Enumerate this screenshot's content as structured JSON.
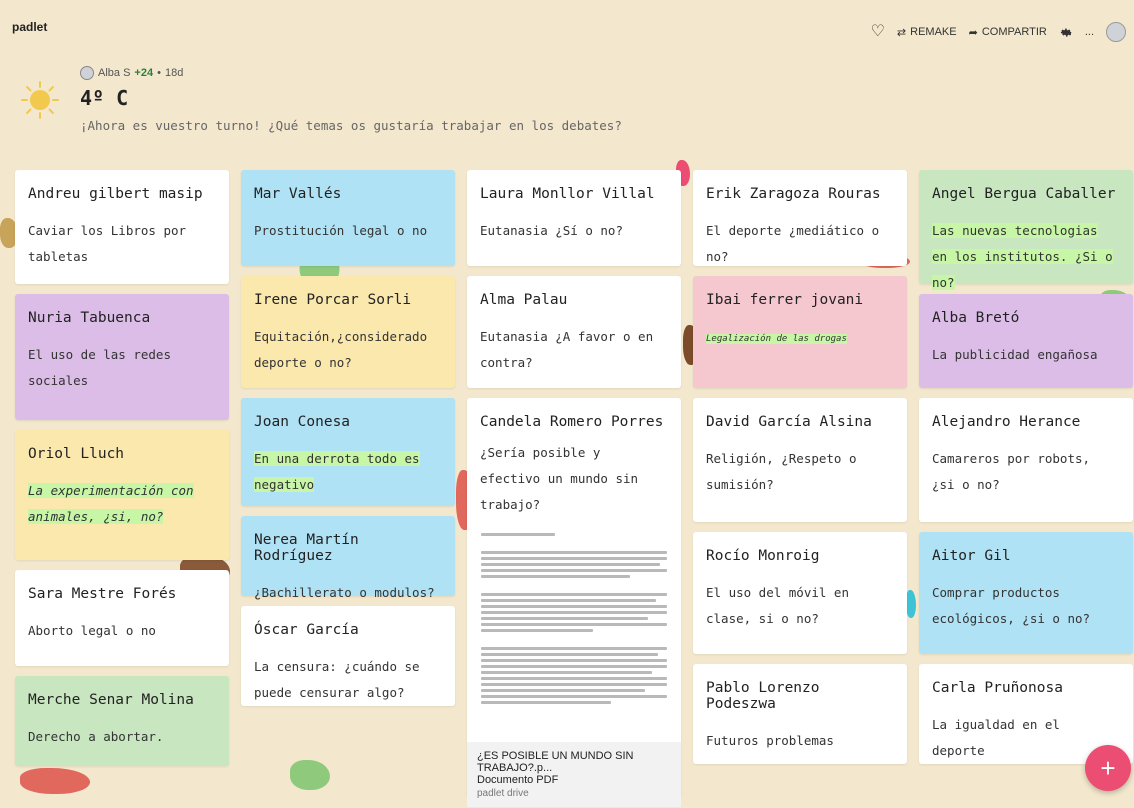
{
  "app": {
    "brand": "padlet",
    "actions": {
      "remake": "REMAKE",
      "share": "COMPARTIR",
      "more": "..."
    }
  },
  "header": {
    "author": "Alba S",
    "contributors": "+24",
    "separator": "•",
    "age": "18d",
    "title": "4º C",
    "description": "¡Ahora es vuestro turno! ¿Qué temas os gustaría trabajar en los debates?"
  },
  "columns": [
    [
      {
        "title": "Andreu gilbert masip",
        "body": "Caviar los Libros por tabletas"
      },
      {
        "title": "Nuria Tabuenca",
        "body": "El uso de las redes sociales"
      },
      {
        "title": "Oriol Lluch",
        "body": "La experimentación con animales, ¿si, no?"
      },
      {
        "title": "Sara Mestre Forés",
        "body": "Aborto legal o no"
      },
      {
        "title": "Merche Senar Molina",
        "body": "Derecho a abortar."
      }
    ],
    [
      {
        "title": "Mar Vallés",
        "body": "Prostitución legal o no"
      },
      {
        "title": "Irene Porcar Sorli",
        "body": "Equitación,¿considerado deporte o no?"
      },
      {
        "title": "Joan Conesa",
        "body": "En una derrota todo es negativo"
      },
      {
        "title": "Nerea Martín Rodríguez",
        "body": "¿Bachillerato o modulos?"
      },
      {
        "title": "Óscar García",
        "body": "La censura: ¿cuándo se puede censurar algo?"
      }
    ],
    [
      {
        "title": "Laura Monllor Villal",
        "body": "Eutanasia ¿Sí o no?"
      },
      {
        "title": "Alma Palau",
        "body": "Eutanasia ¿A favor o en contra?"
      },
      {
        "title": "Candela Romero Porres",
        "body": "¿Sería posible y efectivo un mundo sin trabajo?",
        "attachment": {
          "title": "¿ES POSIBLE UN MUNDO SIN TRABAJO?.p...",
          "type": "Documento PDF",
          "source": "padlet drive"
        }
      }
    ],
    [
      {
        "title": "Erik Zaragoza Rouras",
        "body": "El deporte ¿mediático o no?"
      },
      {
        "title": "Ibai ferrer jovani",
        "body": "Legalización de las drogas"
      },
      {
        "title": "David García Alsina",
        "body": "Religión, ¿Respeto o sumisión?"
      },
      {
        "title": "Rocío Monroig",
        "body": "El uso del móvil en clase, si o no?"
      },
      {
        "title": "Pablo Lorenzo Podeszwa",
        "body": "Futuros problemas"
      }
    ],
    [
      {
        "title": "Angel Bergua Caballer",
        "body": "Las nuevas tecnologias en los institutos. ¿Si o no?"
      },
      {
        "title": "Alba Bretó",
        "body": "La publicidad engañosa"
      },
      {
        "title": "Alejandro Herance",
        "body": "Camareros por robots, ¿si o no?"
      },
      {
        "title": "Aitor Gil",
        "body": "Comprar productos ecológicos, ¿si o no?"
      },
      {
        "title": "Carla Pruñonosa",
        "body": "La igualdad en el deporte"
      }
    ]
  ],
  "fab": {
    "label": "+"
  },
  "colors": {
    "background": "#f3e8cd",
    "card_white": "#ffffff",
    "card_blue": "#b0e2f5",
    "card_green": "#c8e6c0",
    "card_purple": "#dcbde8",
    "card_yellow": "#fbe8ad",
    "card_pink": "#f5c8d0",
    "highlight": "#c7f7a6",
    "fab": "#ec4d73"
  }
}
